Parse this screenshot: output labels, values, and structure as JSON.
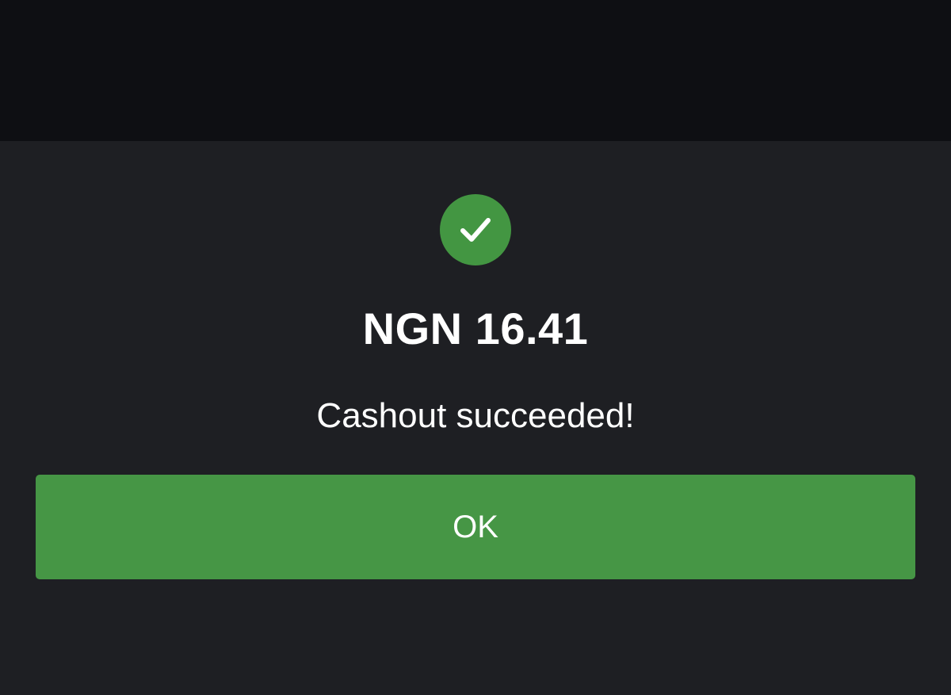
{
  "dialog": {
    "status_icon": "check-icon",
    "amount": "NGN 16.41",
    "message": "Cashout succeeded!",
    "ok_label": "OK"
  },
  "colors": {
    "backdrop": "#0e0f13",
    "sheet_background": "#1e1f23",
    "success_green": "#469645",
    "text": "#ffffff"
  }
}
